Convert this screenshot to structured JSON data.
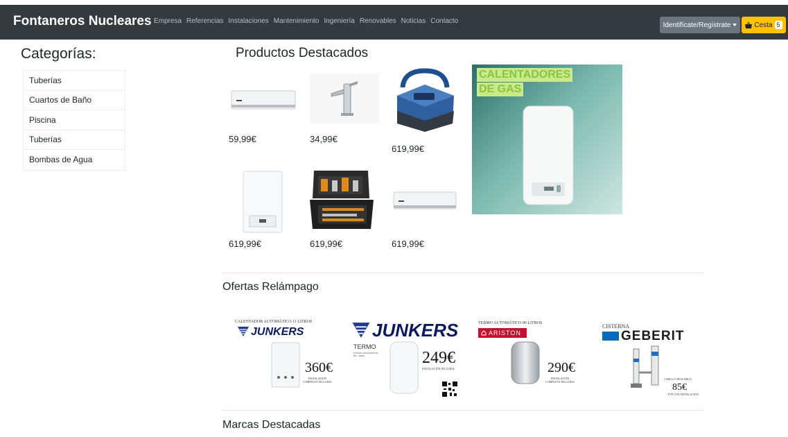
{
  "navbar": {
    "brand": "Fontaneros Nucleares",
    "links": [
      "Empresa",
      "Referencias",
      "Instalaciones",
      "Mantenimiento",
      "Ingeniería",
      "Renovables",
      "Noticias",
      "Contacto"
    ],
    "login_label": "Identifícate/Regístrate",
    "cart_label": "Cesta",
    "cart_count": "5",
    "colors": {
      "bar": "#343a40",
      "login": "#6c757d",
      "cart": "#ffc107"
    }
  },
  "sidebar": {
    "title": "Categorías:",
    "items": [
      "Tuberías",
      "Cuartos de Baño",
      "Piscina",
      "Tuberías",
      "Bombas de Agua"
    ]
  },
  "featured": {
    "title": "Productos Destacados",
    "products": [
      {
        "icon": "air-conditioner-icon",
        "price": "59,99€"
      },
      {
        "icon": "faucet-icon",
        "price": "34,99€"
      },
      {
        "icon": "pool-robot-icon",
        "price": "619,99€"
      },
      {
        "icon": "boiler-icon",
        "price": "619,99€"
      },
      {
        "icon": "toolbox-icon",
        "price": "619,99€"
      },
      {
        "icon": "air-conditioner-icon",
        "price": "619,99€"
      }
    ],
    "promo": {
      "line1": "CALENTADORES",
      "line2": "DE GAS"
    }
  },
  "offers": {
    "title": "Ofertas Relámpago",
    "items": [
      {
        "top": "CALENTADOR AUTOMÁTICO 11 LITROS",
        "brand": "JUNKERS",
        "price": "360€",
        "note": "INSTALACIÓN COMPLETA INCLUIDA"
      },
      {
        "brand": "JUNKERS",
        "sub": "TERMO",
        "sub2": "ELACELL EXCELLENT 50 50L - 1500W",
        "price": "249€",
        "note": "INSTALACIÓN INCLUIDA"
      },
      {
        "top": "TERMO AUTOMÁTICO 80 LITROS",
        "brand": "ARISTON",
        "price": "290€",
        "note": "INSTALACIÓN COMPLETA INCLUIDA"
      },
      {
        "top": "CISTERNA",
        "brand": "GEBERIT",
        "sub": "CARGA Y DESCARGA",
        "price": "85€",
        "note": "PVP CON INSTALACIÓN"
      }
    ]
  },
  "brands": {
    "title": "Marcas Destacadas"
  }
}
